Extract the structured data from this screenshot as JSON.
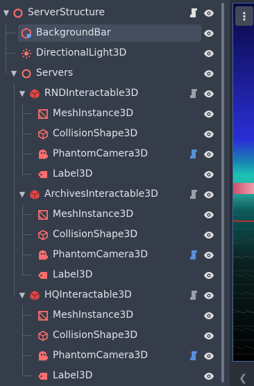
{
  "scene_tree": {
    "nodes": [
      {
        "label": "ServerStructure",
        "icon": "node3d-icon",
        "icon_color": "#ff6e6e",
        "has_arrow": true,
        "has_script": true,
        "script_color": "#e0e0e0"
      },
      {
        "label": "BackgroundBar",
        "icon": "background-bar-icon",
        "icon_color": "#ff6e6e",
        "has_arrow": false,
        "has_script": false,
        "selected": true
      },
      {
        "label": "DirectionalLight3D",
        "icon": "directional-light-icon",
        "icon_color": "#ff6e6e",
        "has_arrow": false,
        "has_script": false
      },
      {
        "label": "Servers",
        "icon": "node3d-icon",
        "icon_color": "#ff6e6e",
        "has_arrow": true,
        "has_script": false
      },
      {
        "label": "RNDInteractable3D",
        "icon": "rigid-body-icon",
        "icon_color": "#e04848",
        "has_arrow": true,
        "has_script": true,
        "script_color": "#9aa0ab"
      },
      {
        "label": "MeshInstance3D",
        "icon": "mesh-instance-icon",
        "icon_color": "#ff6e6e",
        "has_arrow": false,
        "has_script": false
      },
      {
        "label": "CollisionShape3D",
        "icon": "collision-shape-icon",
        "icon_color": "#ff6e6e",
        "has_arrow": false,
        "has_script": false
      },
      {
        "label": "PhantomCamera3D",
        "icon": "phantom-camera-icon",
        "icon_color": "#ff6e6e",
        "has_arrow": false,
        "has_script": true,
        "script_color": "#5a8fd6"
      },
      {
        "label": "Label3D",
        "icon": "label3d-icon",
        "icon_color": "#ff6e6e",
        "has_arrow": false,
        "has_script": false
      },
      {
        "label": "ArchivesInteractable3D",
        "icon": "rigid-body-icon",
        "icon_color": "#e04848",
        "has_arrow": true,
        "has_script": true,
        "script_color": "#9aa0ab"
      },
      {
        "label": "MeshInstance3D",
        "icon": "mesh-instance-icon",
        "icon_color": "#ff6e6e",
        "has_arrow": false,
        "has_script": false
      },
      {
        "label": "CollisionShape3D",
        "icon": "collision-shape-icon",
        "icon_color": "#ff6e6e",
        "has_arrow": false,
        "has_script": false
      },
      {
        "label": "PhantomCamera3D",
        "icon": "phantom-camera-icon",
        "icon_color": "#ff6e6e",
        "has_arrow": false,
        "has_script": true,
        "script_color": "#5a8fd6"
      },
      {
        "label": "Label3D",
        "icon": "label3d-icon",
        "icon_color": "#ff6e6e",
        "has_arrow": false,
        "has_script": false
      },
      {
        "label": "HQInteractable3D",
        "icon": "rigid-body-icon",
        "icon_color": "#e04848",
        "has_arrow": true,
        "has_script": true,
        "script_color": "#9aa0ab"
      },
      {
        "label": "MeshInstance3D",
        "icon": "mesh-instance-icon",
        "icon_color": "#ff6e6e",
        "has_arrow": false,
        "has_script": false
      },
      {
        "label": "CollisionShape3D",
        "icon": "collision-shape-icon",
        "icon_color": "#ff6e6e",
        "has_arrow": false,
        "has_script": false
      },
      {
        "label": "PhantomCamera3D",
        "icon": "phantom-camera-icon",
        "icon_color": "#ff6e6e",
        "has_arrow": false,
        "has_script": true,
        "script_color": "#5a8fd6"
      },
      {
        "label": "Label3D",
        "icon": "label3d-icon",
        "icon_color": "#ff6e6e",
        "has_arrow": false,
        "has_script": false
      }
    ]
  },
  "viewport": {
    "menu_icon": "kebab-menu-icon",
    "collapse_icon": "chevron-left-icon"
  },
  "colors": {
    "panel_bg": "#363d4a",
    "selected_row": "#454e5e",
    "text": "#dfe3ea",
    "eye": "#e0e0e0"
  }
}
